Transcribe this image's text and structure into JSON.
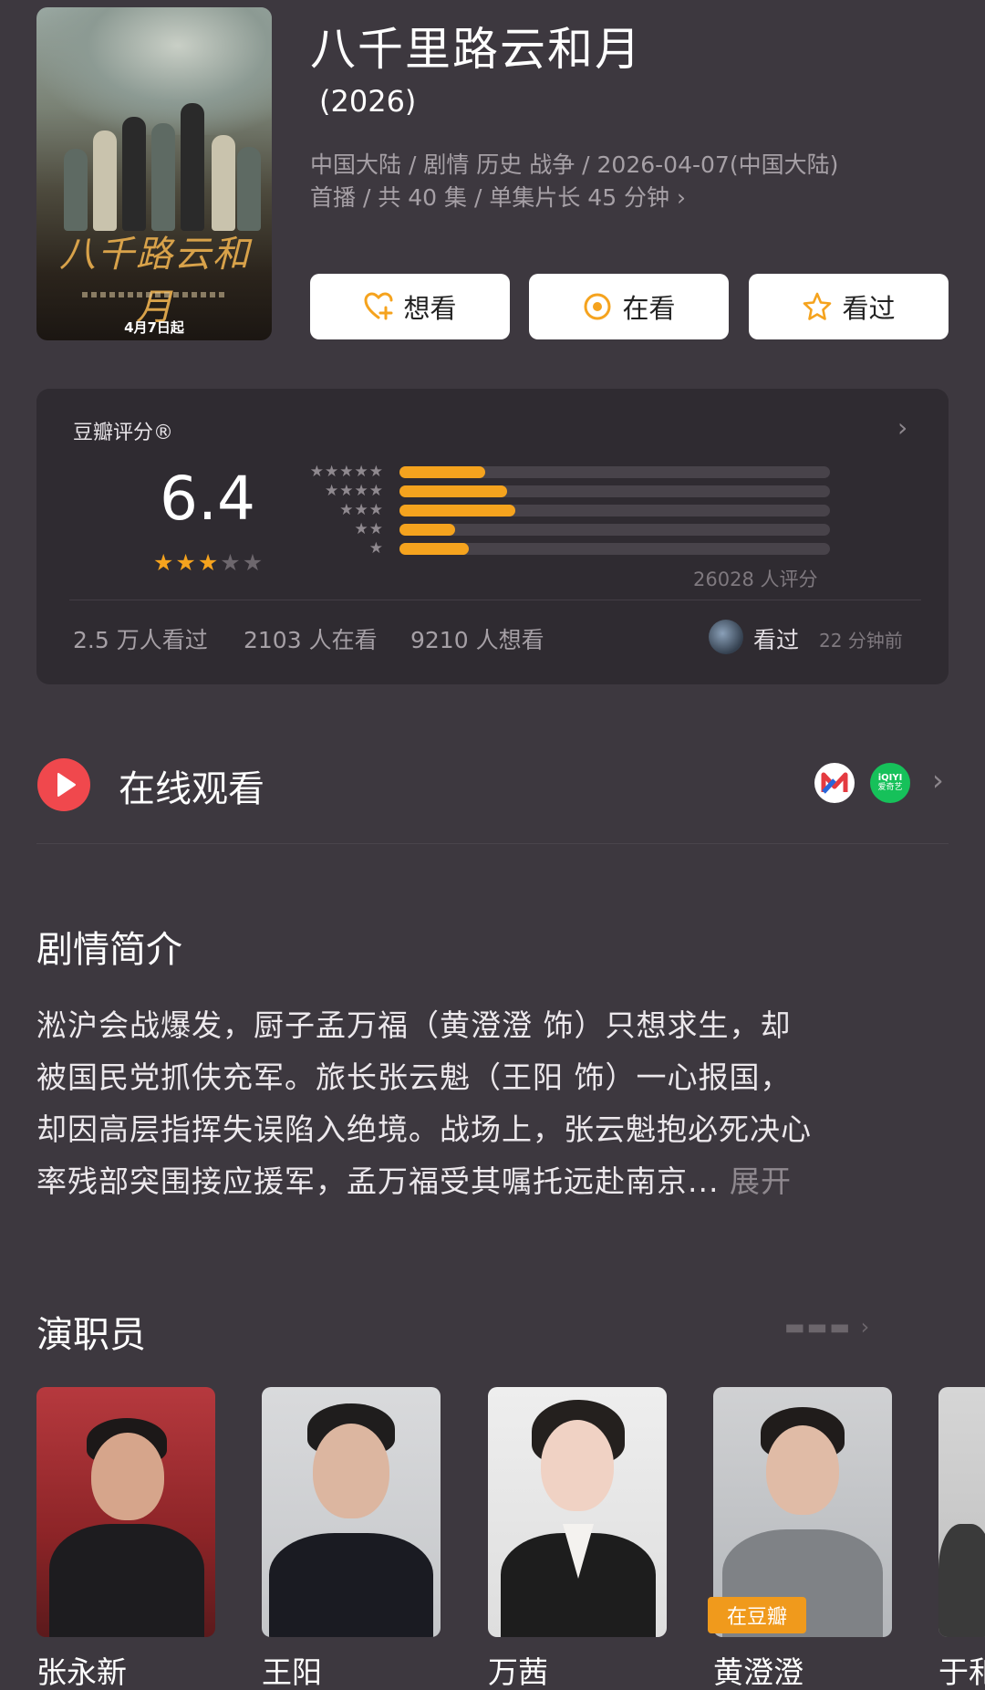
{
  "movie": {
    "title": "八千里路云和月",
    "year": "(2026)",
    "meta_line1": "中国大陆 / 剧情 历史 战争 / 2026-04-07(中国大陆)",
    "meta_line2": "首播 / 共 40 集 / 单集片长 45 分钟 ›",
    "poster": {
      "calligraphy": "八千路云和月",
      "date": "4月7日起"
    }
  },
  "actions": {
    "want": "想看",
    "watching": "在看",
    "watched": "看过"
  },
  "rating": {
    "label": "豆瓣评分®",
    "score": "6.4",
    "stars_filled": 3,
    "stars_total": 5,
    "distribution": [
      {
        "stars": 5,
        "fraction": 0.2
      },
      {
        "stars": 4,
        "fraction": 0.25
      },
      {
        "stars": 3,
        "fraction": 0.27
      },
      {
        "stars": 2,
        "fraction": 0.13
      },
      {
        "stars": 1,
        "fraction": 0.16
      }
    ],
    "votes": "26028 人评分",
    "stats": {
      "watched": "2.5 万人看过",
      "watching": "2103 人在看",
      "want": "9210 人想看"
    },
    "friend": {
      "status": "看过",
      "time": "22 分钟前"
    }
  },
  "online": {
    "title": "在线观看",
    "apps": [
      {
        "name": "M"
      },
      {
        "name": "iQIYI",
        "sub": "爱奇艺"
      }
    ]
  },
  "synopsis": {
    "title": "剧情简介",
    "lines": [
      "淞沪会战爆发，厨子孟万福（黄澄澄 饰）只想求生，却",
      "被国民党抓伕充军。旅长张云魁（王阳 饰）一心报国，",
      "却因高层指挥失误陷入绝境。战场上，张云魁抱必死决心",
      "率残部突围接应援军，孟万福受其嘱托远赴南京..."
    ],
    "expand": "展开"
  },
  "cast": {
    "title": "演职员",
    "members": [
      {
        "name": "张永新"
      },
      {
        "name": "王阳"
      },
      {
        "name": "万茜"
      },
      {
        "name": "黄澄澄",
        "badge": "在豆瓣"
      },
      {
        "name": "于和"
      }
    ]
  }
}
